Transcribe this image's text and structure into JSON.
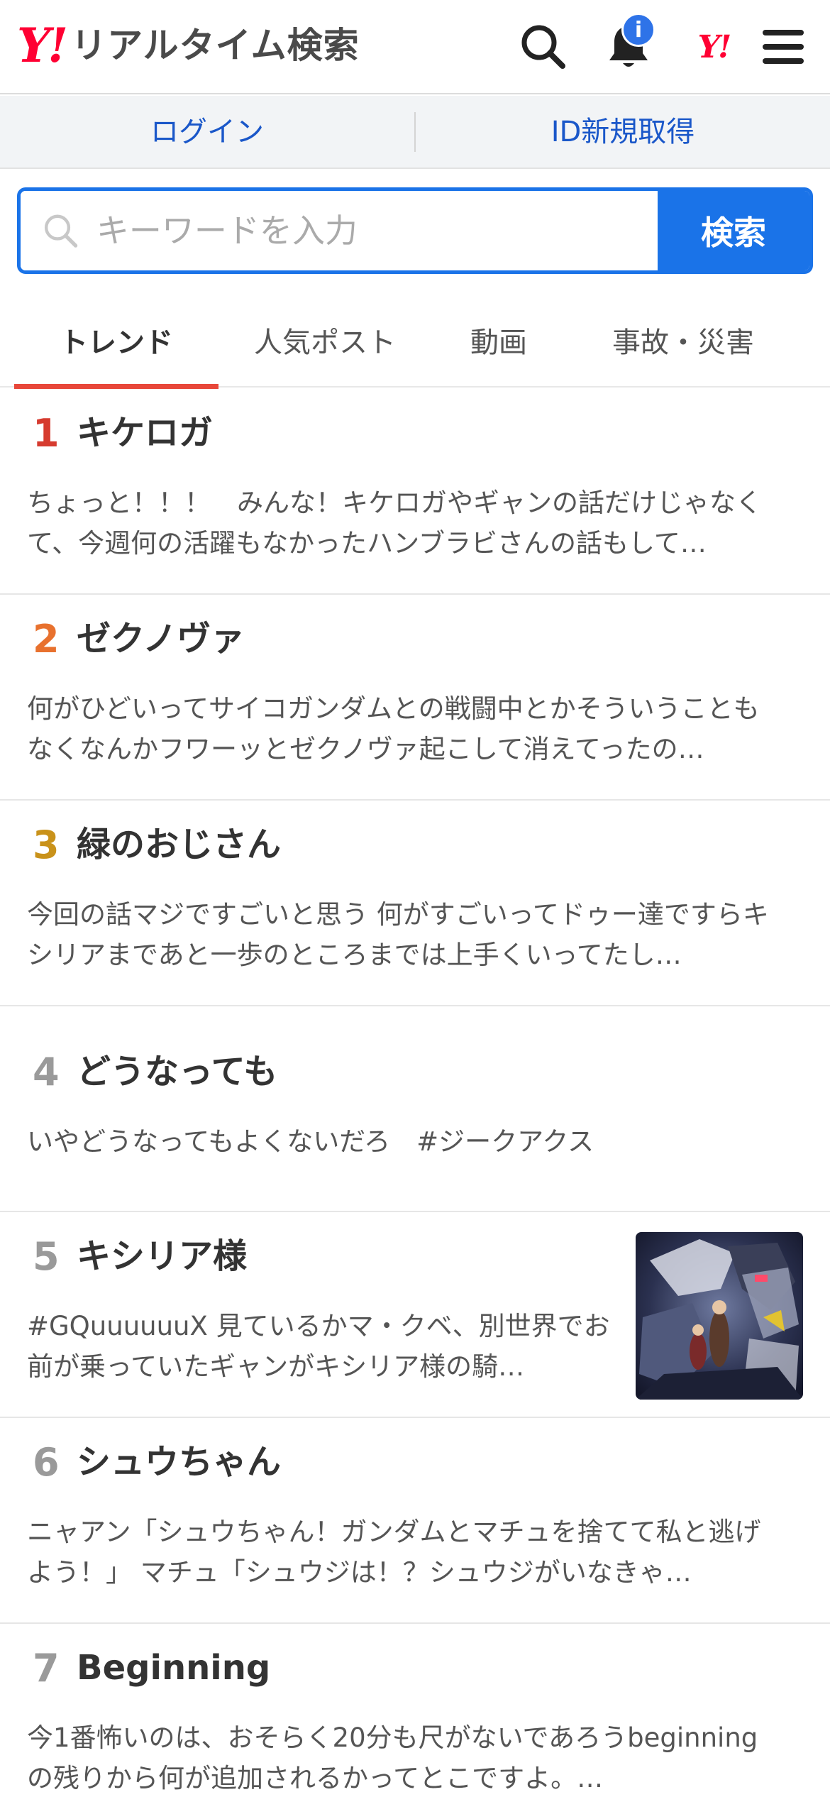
{
  "header": {
    "logo_mark": "Y!",
    "logo_text": "リアルタイム検索",
    "notification_badge": "i",
    "yj_mark": "Y!"
  },
  "login_bar": {
    "login_label": "ログイン",
    "register_label": "ID新規取得"
  },
  "search": {
    "placeholder": "キーワードを入力",
    "button_label": "検索"
  },
  "tabs": [
    {
      "label": "トレンド",
      "active": true
    },
    {
      "label": "人気ポスト",
      "active": false
    },
    {
      "label": "動画",
      "active": false
    },
    {
      "label": "事故・災害",
      "active": false
    }
  ],
  "trends": [
    {
      "rank": "1",
      "title": "キケロガ",
      "desc": "ちょっと！！！　みんな！キケロガやギャンの話だけじゃなくて、今週何の活躍もなかったハンブラビさんの話もして…",
      "rank_color": "#d63b2f"
    },
    {
      "rank": "2",
      "title": "ゼクノヴァ",
      "desc": "何がひどいってサイコガンダムとの戦闘中とかそういうこともなくなんかフワーッとゼクノヴァ起こして消えてったの…",
      "rank_color": "#e8712e"
    },
    {
      "rank": "3",
      "title": "緑のおじさん",
      "desc": "今回の話マジですごいと思う 何がすごいってドゥー達ですらキシリアまであと一歩のところまでは上手くいってたし…",
      "rank_color": "#c9921a"
    },
    {
      "rank": "4",
      "title": "どうなっても",
      "desc": "いやどうなってもよくないだろ　#ジークアクス",
      "rank_color": "#9a9a9a"
    },
    {
      "rank": "5",
      "title": "キシリア様",
      "desc": "#GQuuuuuuX 見ているかマ・クベ、別世界でお前が乗っていたギャンがキシリア様の騎…",
      "rank_color": "#9a9a9a"
    },
    {
      "rank": "6",
      "title": "シュウちゃん",
      "desc": "ニャアン「シュウちゃん！ガンダムとマチュを捨てて私と逃げよう！」 マチュ「シュウジは！？シュウジがいなきゃ…",
      "rank_color": "#9a9a9a"
    },
    {
      "rank": "7",
      "title": "Beginning",
      "desc": "今1番怖いのは、おそらく20分も尺がないであろうbeginningの残りから何が追加されるかってとこですよ。…",
      "rank_color": "#9a9a9a"
    }
  ]
}
